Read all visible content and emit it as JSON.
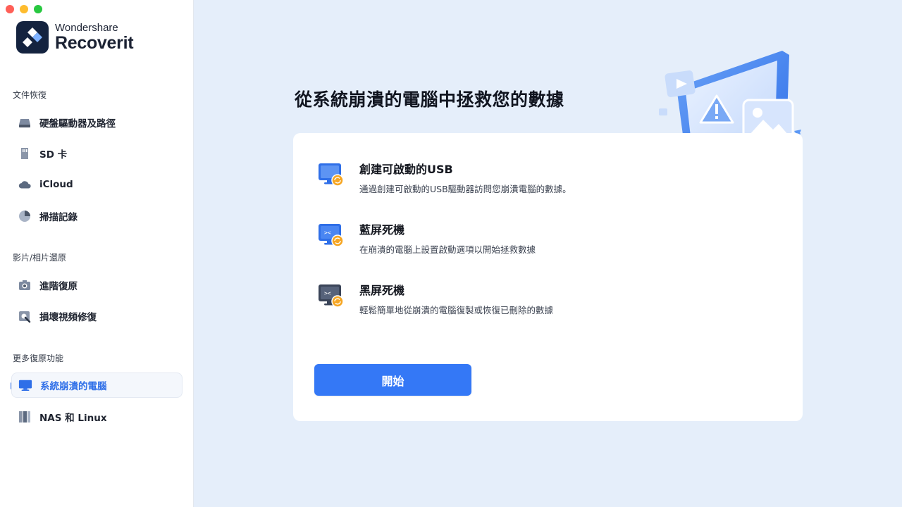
{
  "window": {
    "controls": [
      "close",
      "minimize",
      "zoom"
    ]
  },
  "brand": {
    "top": "Wondershare",
    "name": "Recoverit"
  },
  "sidebar": {
    "sections": [
      {
        "title": "文件恢復",
        "items": [
          {
            "label": "硬盤驅動器及路徑",
            "icon": "hard-drive-icon"
          },
          {
            "label": "SD 卡",
            "icon": "sd-card-icon"
          },
          {
            "label": "iCloud",
            "icon": "icloud-icon"
          },
          {
            "label": "掃描記錄",
            "icon": "pie-chart-icon"
          }
        ]
      },
      {
        "title": "影片/相片還原",
        "items": [
          {
            "label": "進階復原",
            "icon": "camera-icon"
          },
          {
            "label": "損壞視頻修復",
            "icon": "video-repair-icon"
          }
        ]
      },
      {
        "title": "更多復原功能",
        "items": [
          {
            "label": "系統崩潰的電腦",
            "icon": "monitor-icon",
            "active": true
          },
          {
            "label": "NAS 和 Linux",
            "icon": "nas-icon"
          }
        ]
      }
    ]
  },
  "main": {
    "title": "從系統崩潰的電腦中拯救您的數據",
    "options": [
      {
        "title": "創建可啟動的USB",
        "desc": "通過創建可啟動的USB驅動器訪問您崩潰電腦的數據。",
        "icon": "usb-monitor-icon"
      },
      {
        "title": "藍屏死機",
        "desc": "在崩潰的電腦上設置啟動選項以開始拯救數據",
        "icon": "blue-screen-icon"
      },
      {
        "title": "黑屏死機",
        "desc": "輕鬆簡單地從崩潰的電腦復製或恢復已刪除的數據",
        "icon": "black-screen-icon"
      }
    ],
    "start_button": "開始"
  },
  "colors": {
    "accent": "#3478f6",
    "sidebar_bg": "#ffffff",
    "main_bg": "#e5eefa",
    "active_text": "#2f6fe8"
  }
}
